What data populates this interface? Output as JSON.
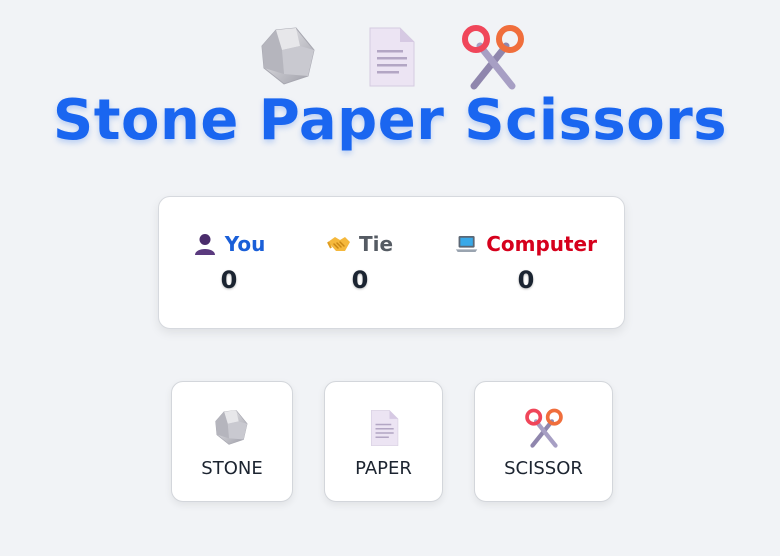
{
  "header": {
    "title": "Stone Paper Scissors",
    "icons": [
      "stone-icon",
      "paper-icon",
      "scissors-icon"
    ]
  },
  "scoreboard": {
    "you": {
      "label": "You",
      "icon": "person-icon",
      "value": "0"
    },
    "tie": {
      "label": "Tie",
      "icon": "handshake-icon",
      "value": "0"
    },
    "computer": {
      "label": "Computer",
      "icon": "laptop-icon",
      "value": "0"
    }
  },
  "choices": [
    {
      "label": "STONE",
      "icon": "stone-icon"
    },
    {
      "label": "PAPER",
      "icon": "paper-icon"
    },
    {
      "label": "SCISSOR",
      "icon": "scissors-icon"
    }
  ],
  "colors": {
    "title": "#1a66f0",
    "you": "#1a5fd8",
    "tie": "#555b63",
    "computer": "#d6001c",
    "background": "#f1f3f6"
  }
}
